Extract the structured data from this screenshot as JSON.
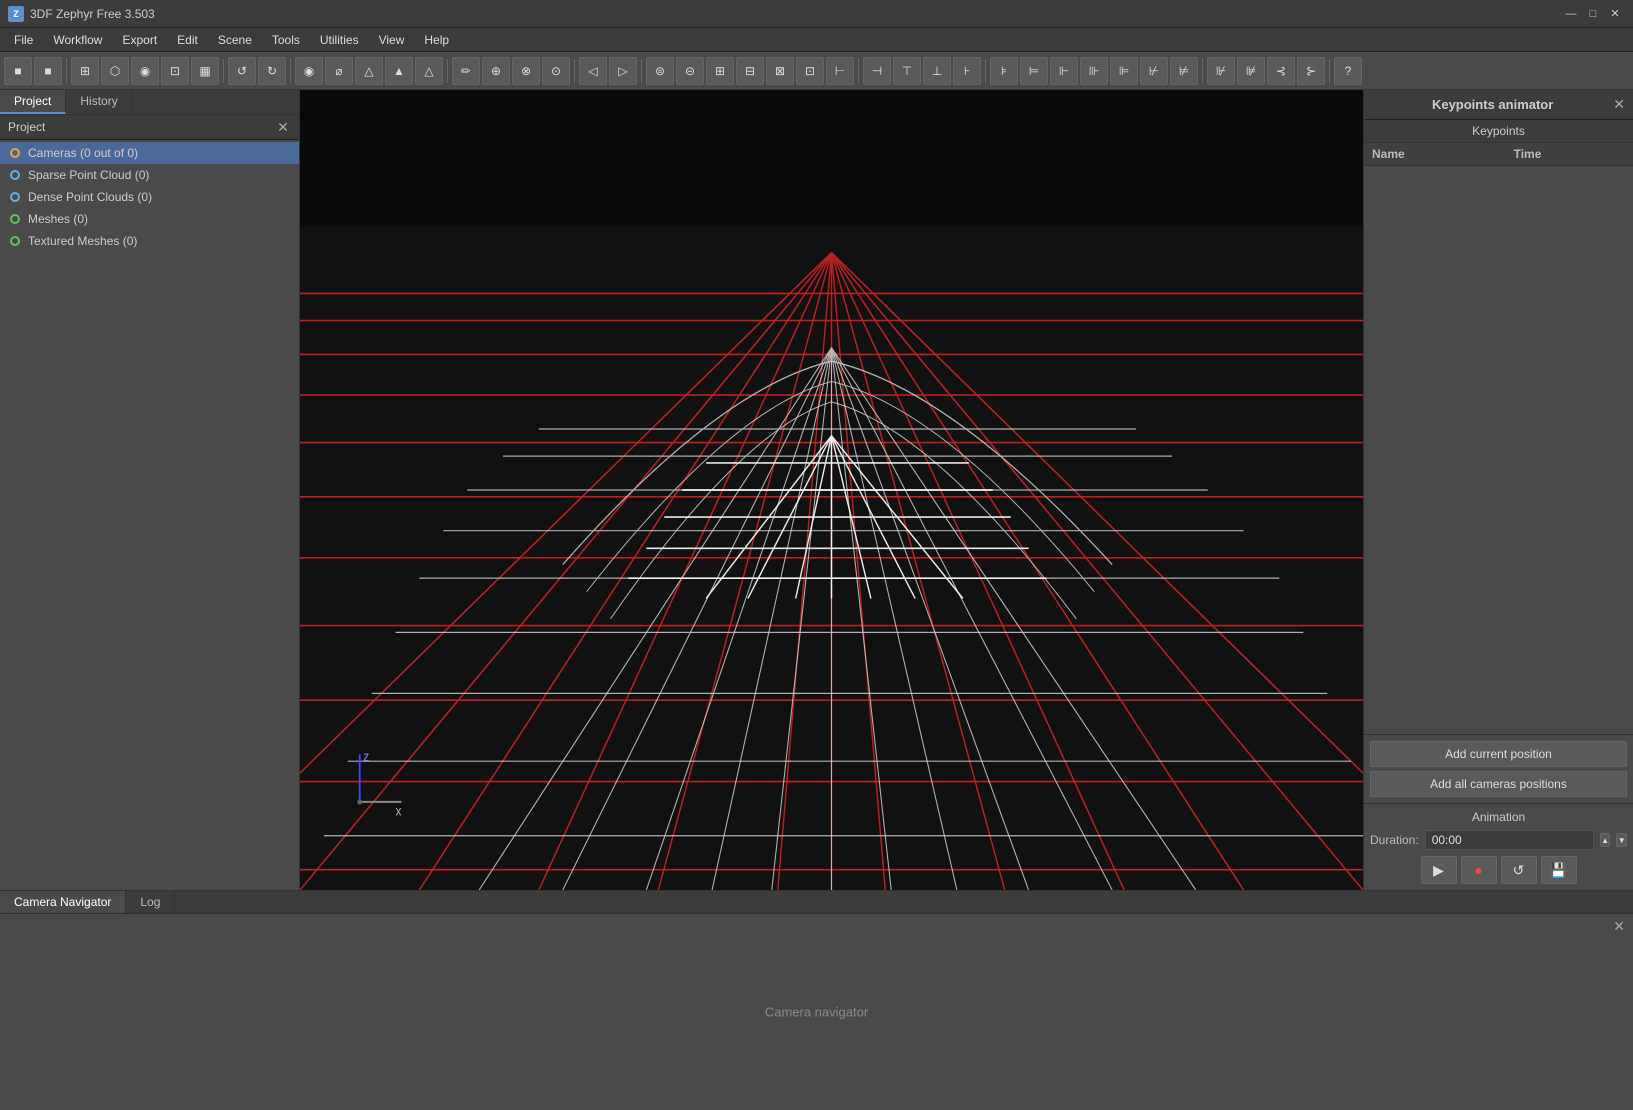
{
  "titleBar": {
    "appName": "3DF Zephyr Free 3.503",
    "icon": "Z"
  },
  "windowControls": {
    "minimize": "—",
    "maximize": "□",
    "close": "✕"
  },
  "menuBar": {
    "items": [
      "File",
      "Workflow",
      "Export",
      "Edit",
      "Scene",
      "Tools",
      "Utilities",
      "View",
      "Help"
    ]
  },
  "toolbar": {
    "groups": [
      [
        "■",
        "■"
      ],
      [
        "⊞",
        "⊡",
        "⬡",
        "◉",
        "⬛",
        "▦"
      ],
      [
        "↺",
        "↻",
        "►"
      ],
      [
        "🔍",
        "✎",
        "△",
        "△",
        "△"
      ],
      [
        "✎",
        "⊕",
        "⊗",
        "✦"
      ],
      [
        "◁",
        "▷"
      ],
      [
        "⊙",
        "⊚",
        "⊛",
        "⊜",
        "⊝",
        "⊞"
      ],
      [
        "⊟",
        "⊠",
        "⊡",
        "⊢"
      ],
      [
        "⊣",
        "⊤",
        "⊥",
        "⊦"
      ],
      [
        "⊧",
        "⊨",
        "⊩",
        "⊪"
      ],
      [
        "?"
      ]
    ]
  },
  "leftPanel": {
    "tabs": [
      {
        "id": "project",
        "label": "Project",
        "active": true
      },
      {
        "id": "history",
        "label": "History",
        "active": false
      }
    ],
    "projectHeader": "Project",
    "treeItems": [
      {
        "id": "cameras",
        "label": "Cameras (0 out of 0)",
        "iconType": "cameras",
        "selected": true
      },
      {
        "id": "sparse",
        "label": "Sparse Point Cloud (0)",
        "iconType": "cloud",
        "selected": false
      },
      {
        "id": "dense",
        "label": "Dense Point Clouds (0)",
        "iconType": "cloud",
        "selected": false
      },
      {
        "id": "meshes",
        "label": "Meshes (0)",
        "iconType": "mesh",
        "selected": false
      },
      {
        "id": "textured",
        "label": "Textured Meshes (0)",
        "iconType": "mesh",
        "selected": false
      }
    ]
  },
  "rightPanel": {
    "title": "Keypoints animator",
    "keypoints": {
      "sectionLabel": "Keypoints",
      "columns": [
        "Name",
        "Time"
      ],
      "rows": []
    },
    "buttons": {
      "addCurrentPosition": "Add current position",
      "addAllCamerasPositions": "Add all cameras positions"
    },
    "animation": {
      "label": "Animation",
      "durationLabel": "Duration:",
      "durationValue": "00:00",
      "controls": {
        "play": "▶",
        "record": "●",
        "loop": "↺",
        "save": "💾"
      }
    }
  },
  "bottomPanel": {
    "tabs": [
      {
        "id": "camera-navigator",
        "label": "Camera Navigator",
        "active": true
      },
      {
        "id": "log",
        "label": "Log",
        "active": false
      }
    ],
    "cameraNavigatorLabel": "Camera navigator"
  }
}
